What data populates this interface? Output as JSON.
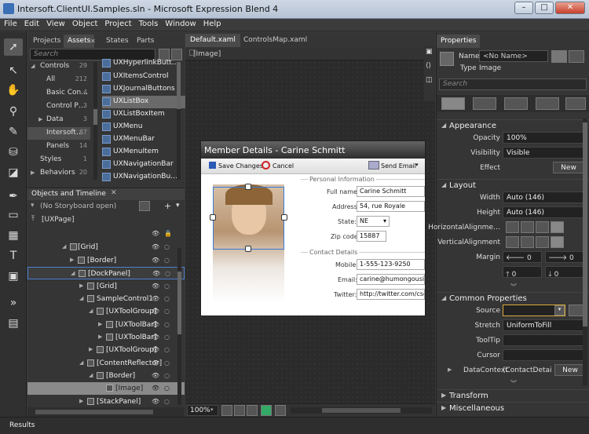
{
  "title": "Intersoft.ClientUI.Samples.sln - Microsoft Expression Blend 4",
  "window_controls": {
    "minimize": "–",
    "maximize": "□",
    "close": "✕"
  },
  "menu": [
    "File",
    "Edit",
    "View",
    "Object",
    "Project",
    "Tools",
    "Window",
    "Help"
  ],
  "left_panel": {
    "tabs": [
      "Projects",
      "Assets",
      "States",
      "Parts"
    ],
    "search_placeholder": "Search",
    "categories": [
      {
        "label": "Controls",
        "count": "29"
      },
      {
        "label": "All",
        "count": "212"
      },
      {
        "label": "Basic Con…",
        "count": "4"
      },
      {
        "label": "Control P…",
        "count": "3"
      },
      {
        "label": "Data",
        "count": "3"
      },
      {
        "label": "Intersoft…",
        "count": "87"
      },
      {
        "label": "Panels",
        "count": "14"
      },
      {
        "label": "Styles",
        "count": "1"
      },
      {
        "label": "Behaviors",
        "count": "20"
      }
    ],
    "assets": [
      "UXHyperlinkButt…",
      "UXItemsControl",
      "UXJournalButtons",
      "UXListBox",
      "UXListBoxItem",
      "UXMenu",
      "UXMenuBar",
      "UXMenuItem",
      "UXNavigationBar",
      "UXNavigationBu…"
    ],
    "objects_title": "Objects and Timeline",
    "storyboard_label": "(No Storyboard open)",
    "tree": [
      {
        "label": "[UXPage]"
      },
      {
        "label": "[Grid]"
      },
      {
        "label": "[Border]"
      },
      {
        "label": "[DockPanel]"
      },
      {
        "label": "[Grid]"
      },
      {
        "label": "SampleControl1"
      },
      {
        "label": "[UXToolGroup]"
      },
      {
        "label": "[UXToolBar]"
      },
      {
        "label": "[UXToolBar]"
      },
      {
        "label": "[UXToolGroup]"
      },
      {
        "label": "[ContentReflector]"
      },
      {
        "label": "[Border]"
      },
      {
        "label": "[Image]"
      },
      {
        "label": "[StackPanel]"
      }
    ]
  },
  "documents": {
    "tabs": [
      "Default.xaml",
      "ControlsMap.xaml"
    ],
    "breadcrumb": "[Image]",
    "zoom": "100%"
  },
  "member_window": {
    "title": "Member Details - Carine Schmitt",
    "save_label": "Save Changes",
    "cancel_label": "Cancel",
    "send_email_label": "Send Email",
    "personal_header": "Personal Information",
    "contact_header": "Contact Details",
    "fields": {
      "fullname_label": "Full name:",
      "fullname": "Carine Schmitt",
      "address_label": "Address:",
      "address": "54, rue Royale",
      "state_label": "State:",
      "state": "NE",
      "zip_label": "Zip code:",
      "zip": "15887",
      "mobile_label": "Mobile:",
      "mobile": "1-555-123-9250",
      "email_label": "Email:",
      "email": "carine@humongousinsu",
      "twitter_label": "Twitter:",
      "twitter": "http://twitter.com/cschr"
    }
  },
  "properties": {
    "tabs": [
      "Properties"
    ],
    "name_label": "Name",
    "name_value": "<No Name>",
    "type_label": "Type",
    "type_value": "Image",
    "search_placeholder": "Search",
    "appearance": {
      "header": "Appearance",
      "opacity_label": "Opacity",
      "opacity": "100%",
      "visibility_label": "Visibility",
      "visibility": "Visible",
      "effect_label": "Effect",
      "effect_btn": "New"
    },
    "layout": {
      "header": "Layout",
      "width_label": "Width",
      "width": "Auto (146)",
      "height_label": "Height",
      "height": "Auto (146)",
      "halign_label": "HorizontalAlignme…",
      "valign_label": "VerticalAlignment",
      "margin_label": "Margin",
      "margins": [
        "0",
        "0",
        "0",
        "0"
      ]
    },
    "common": {
      "header": "Common Properties",
      "source_label": "Source",
      "stretch_label": "Stretch",
      "stretch": "UniformToFill",
      "tooltip_label": "ToolTip",
      "cursor_label": "Cursor",
      "datacontext_label": "DataContext",
      "datacontext": "(ContactDetail…",
      "datacontext_btn": "New"
    },
    "transform_header": "Transform",
    "misc_header": "Miscellaneous"
  },
  "statusbar": {
    "results": "Results"
  },
  "colors": {
    "accent": "#4a7fd0",
    "panel": "#353535",
    "canvas": "#2b2b2b"
  }
}
